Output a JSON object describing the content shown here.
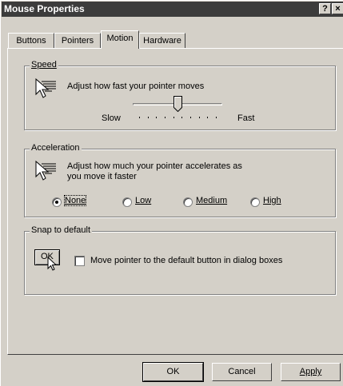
{
  "window": {
    "title": "Mouse Properties",
    "help_button": "?",
    "close_button": "×"
  },
  "tabs": [
    {
      "label": "Buttons",
      "active": false
    },
    {
      "label": "Pointers",
      "active": false
    },
    {
      "label": "Motion",
      "active": true
    },
    {
      "label": "Hardware",
      "active": false
    }
  ],
  "speed": {
    "group_title": "Speed",
    "description": "Adjust how fast your pointer moves",
    "slow_label": "Slow",
    "fast_label": "Fast",
    "slider_value": 0.5,
    "tick_count": 10
  },
  "acceleration": {
    "group_title": "Acceleration",
    "description_line1": "Adjust how much your pointer accelerates as",
    "description_line2": "you move it faster",
    "options": [
      "None",
      "Low",
      "Medium",
      "High"
    ],
    "selected": "None"
  },
  "snap": {
    "group_title": "Snap to default",
    "icon_label": "OK",
    "checkbox_label": "Move pointer to the default button in dialog boxes",
    "checked": false
  },
  "buttons": {
    "ok": "OK",
    "cancel": "Cancel",
    "apply": "Apply"
  },
  "icons": {
    "pointer_speed": "pointer-speed-icon",
    "pointer_accel": "pointer-acceleration-icon",
    "snap": "snap-to-default-icon"
  }
}
